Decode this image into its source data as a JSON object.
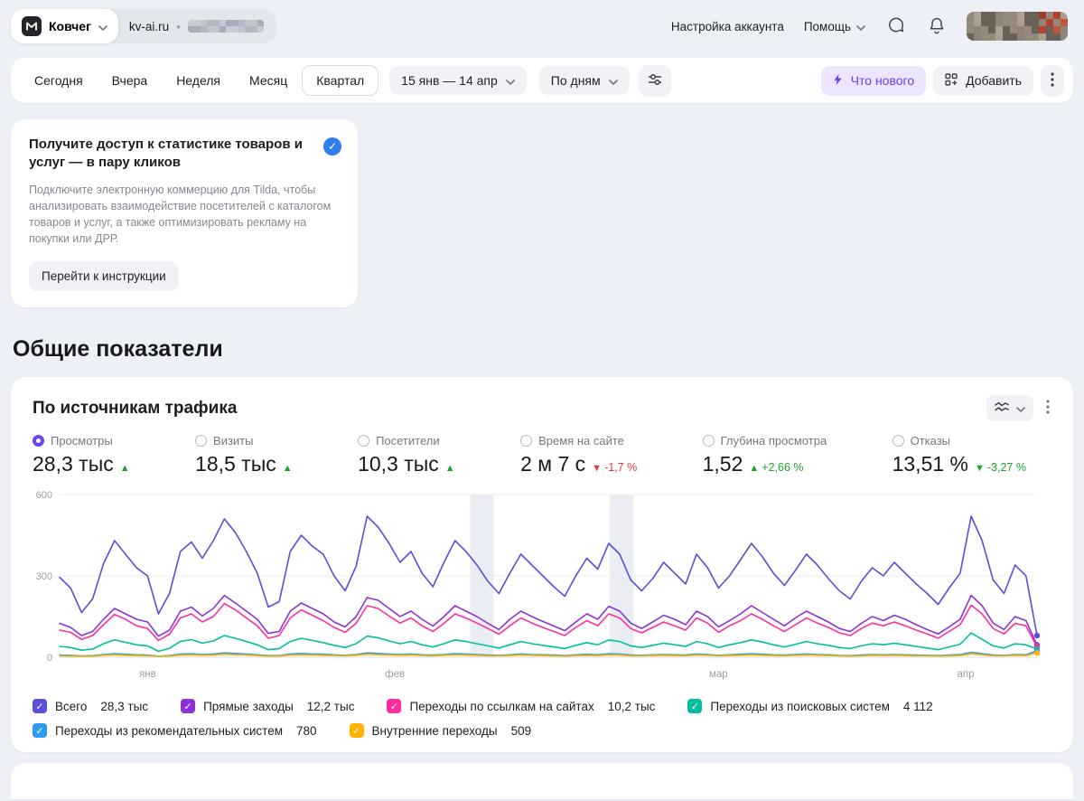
{
  "header": {
    "counter_name": "Ковчег",
    "site": "kv-ai.ru",
    "separator": "•",
    "account_settings": "Настройка аккаунта",
    "help": "Помощь"
  },
  "toolbar": {
    "periods": [
      "Сегодня",
      "Вчера",
      "Неделя",
      "Месяц",
      "Квартал"
    ],
    "selected_period": "Квартал",
    "date_range": "15 янв — 14 апр",
    "granularity": "По дням",
    "whats_new": "Что нового",
    "add": "Добавить"
  },
  "promo": {
    "title": "Получите доступ к статистике товаров и услуг — в пару кликов",
    "body": "Подключите электронную коммерцию для Tilda, чтобы анализировать взаимодействие посетителей с каталогом товаров и услуг, а также оптимизировать рекламу на покупки или ДРР.",
    "cta": "Перейти к инструкции"
  },
  "section_title": "Общие показатели",
  "widget": {
    "title": "По источникам трафика",
    "metrics": [
      {
        "label": "Просмотры",
        "value": "28,3 тыс",
        "dir": "up",
        "delta": "",
        "delta_color": "green",
        "selected": true
      },
      {
        "label": "Визиты",
        "value": "18,5 тыс",
        "dir": "up",
        "delta": "",
        "delta_color": "green",
        "selected": false
      },
      {
        "label": "Посетители",
        "value": "10,3 тыс",
        "dir": "up",
        "delta": "",
        "delta_color": "green",
        "selected": false
      },
      {
        "label": "Время на сайте",
        "value": "2 м 7 с",
        "dir": "down",
        "delta": "-1,7 %",
        "delta_color": "red",
        "selected": false
      },
      {
        "label": "Глубина просмотра",
        "value": "1,52",
        "dir": "up",
        "delta": "+2,66 %",
        "delta_color": "green",
        "selected": false
      },
      {
        "label": "Отказы",
        "value": "13,51 %",
        "dir": "down",
        "delta": "-3,27 %",
        "delta_color": "green",
        "selected": false
      }
    ],
    "legend": [
      {
        "label": "Всего",
        "value": "28,3 тыс",
        "color": "#5a4fd8"
      },
      {
        "label": "Прямые заходы",
        "value": "12,2 тыс",
        "color": "#8c33d6"
      },
      {
        "label": "Переходы по ссылкам на сайтах",
        "value": "10,2 тыс",
        "color": "#ff2e9c"
      },
      {
        "label": "Переходы из поисковых систем",
        "value": "4 112",
        "color": "#00bfa0"
      },
      {
        "label": "Переходы из рекомендательных систем",
        "value": "780",
        "color": "#2f9bf0"
      },
      {
        "label": "Внутренние переходы",
        "value": "509",
        "color": "#ffb200"
      }
    ]
  },
  "chart_data": {
    "type": "line",
    "title": "По источникам трафика",
    "x_unit": "день",
    "x_range": "15 янв — 14 апр",
    "granularity": "По дням",
    "x_tick_labels": [
      "янв",
      "фев",
      "мар",
      "апр"
    ],
    "x_tick_positions": [
      0.09,
      0.343,
      0.674,
      0.927
    ],
    "ylim": [
      0,
      600
    ],
    "y_ticks": [
      0,
      300,
      600
    ],
    "grid": true,
    "legend_position": "bottom",
    "highlight_bands": [
      [
        0.42,
        0.444
      ],
      [
        0.563,
        0.587
      ]
    ],
    "series": [
      {
        "name": "Всего",
        "total": "28,3 тыс",
        "color": "#5a4fd8",
        "values": [
          295,
          255,
          165,
          215,
          345,
          430,
          380,
          330,
          300,
          160,
          235,
          390,
          425,
          365,
          430,
          510,
          460,
          390,
          310,
          185,
          205,
          390,
          450,
          410,
          380,
          300,
          245,
          335,
          520,
          480,
          420,
          350,
          390,
          310,
          260,
          350,
          430,
          390,
          340,
          280,
          235,
          310,
          380,
          340,
          300,
          260,
          225,
          300,
          365,
          325,
          420,
          380,
          285,
          245,
          290,
          350,
          310,
          270,
          380,
          330,
          255,
          300,
          360,
          420,
          370,
          310,
          265,
          320,
          380,
          340,
          290,
          245,
          215,
          280,
          330,
          300,
          350,
          310,
          270,
          235,
          195,
          255,
          310,
          520,
          430,
          285,
          235,
          340,
          300,
          80
        ]
      },
      {
        "name": "Прямые заходы",
        "total": "12,2 тыс",
        "color": "#8c33d6",
        "values": [
          125,
          110,
          80,
          95,
          140,
          180,
          160,
          140,
          130,
          78,
          100,
          170,
          185,
          152,
          180,
          228,
          200,
          170,
          140,
          88,
          95,
          170,
          200,
          180,
          160,
          130,
          112,
          150,
          220,
          210,
          180,
          150,
          170,
          140,
          115,
          150,
          190,
          170,
          150,
          125,
          102,
          140,
          170,
          150,
          132,
          115,
          98,
          130,
          160,
          140,
          188,
          170,
          126,
          106,
          130,
          155,
          140,
          120,
          170,
          150,
          112,
          135,
          160,
          190,
          165,
          140,
          116,
          145,
          170,
          150,
          130,
          106,
          95,
          125,
          150,
          135,
          155,
          140,
          120,
          102,
          86,
          112,
          140,
          228,
          190,
          126,
          102,
          150,
          135,
          45
        ]
      },
      {
        "name": "Переходы по ссылкам на сайтах",
        "total": "10,2 тыс",
        "color": "#ff2e9c",
        "values": [
          100,
          92,
          66,
          80,
          120,
          158,
          140,
          116,
          106,
          62,
          85,
          145,
          160,
          130,
          150,
          198,
          175,
          145,
          116,
          70,
          80,
          145,
          175,
          155,
          135,
          110,
          92,
          125,
          190,
          180,
          152,
          126,
          145,
          116,
          95,
          125,
          160,
          145,
          126,
          106,
          85,
          116,
          145,
          126,
          110,
          95,
          80,
          110,
          135,
          116,
          160,
          145,
          106,
          90,
          110,
          130,
          116,
          100,
          145,
          126,
          92,
          116,
          135,
          160,
          140,
          116,
          95,
          120,
          145,
          126,
          110,
          90,
          80,
          106,
          126,
          116,
          130,
          116,
          100,
          86,
          70,
          95,
          120,
          192,
          160,
          106,
          86,
          125,
          116,
          38
        ]
      },
      {
        "name": "Переходы из поисковых систем",
        "total": "4 112",
        "color": "#00bfa0",
        "values": [
          40,
          36,
          26,
          30,
          50,
          64,
          55,
          46,
          42,
          22,
          33,
          58,
          65,
          52,
          60,
          80,
          70,
          58,
          46,
          28,
          32,
          58,
          70,
          62,
          54,
          44,
          36,
          50,
          78,
          72,
          60,
          50,
          58,
          46,
          38,
          50,
          64,
          58,
          50,
          42,
          34,
          46,
          58,
          50,
          44,
          38,
          32,
          44,
          54,
          46,
          64,
          58,
          42,
          36,
          44,
          52,
          46,
          40,
          58,
          50,
          36,
          46,
          54,
          64,
          56,
          46,
          38,
          48,
          58,
          50,
          44,
          36,
          32,
          42,
          50,
          46,
          52,
          46,
          40,
          34,
          28,
          38,
          48,
          90,
          66,
          42,
          34,
          50,
          46,
          30
        ]
      },
      {
        "name": "Переходы из рекомендательных систем",
        "total": "780",
        "color": "#2f9bf0",
        "values": [
          8,
          7,
          5,
          6,
          10,
          13,
          11,
          9,
          8,
          4,
          6,
          12,
          13,
          10,
          12,
          16,
          14,
          12,
          9,
          6,
          6,
          12,
          14,
          12,
          11,
          9,
          7,
          10,
          16,
          14,
          12,
          10,
          12,
          9,
          8,
          10,
          13,
          12,
          10,
          8,
          7,
          9,
          12,
          10,
          9,
          8,
          6,
          9,
          11,
          9,
          13,
          12,
          8,
          7,
          9,
          10,
          9,
          8,
          12,
          10,
          7,
          9,
          11,
          13,
          11,
          9,
          8,
          10,
          12,
          10,
          9,
          7,
          6,
          8,
          10,
          9,
          10,
          9,
          8,
          7,
          6,
          8,
          10,
          18,
          13,
          8,
          7,
          10,
          9,
          24
        ]
      },
      {
        "name": "Внутренние переходы",
        "total": "509",
        "color": "#ffb200",
        "values": [
          5,
          4,
          3,
          4,
          7,
          9,
          7,
          6,
          5,
          3,
          4,
          8,
          9,
          7,
          8,
          11,
          9,
          8,
          6,
          4,
          4,
          8,
          9,
          8,
          7,
          6,
          5,
          7,
          11,
          9,
          8,
          7,
          8,
          6,
          5,
          7,
          9,
          8,
          7,
          5,
          5,
          6,
          8,
          7,
          6,
          5,
          4,
          6,
          7,
          6,
          9,
          8,
          5,
          5,
          6,
          7,
          6,
          5,
          8,
          7,
          5,
          6,
          7,
          9,
          7,
          6,
          5,
          7,
          8,
          7,
          6,
          5,
          4,
          5,
          7,
          6,
          7,
          6,
          5,
          5,
          4,
          5,
          6,
          12,
          9,
          5,
          5,
          7,
          6,
          16
        ]
      }
    ]
  },
  "icons": {
    "chevron-down": "⌄",
    "bolt": "⚡",
    "add-widget": "⊞",
    "filter": "sliders",
    "kebab": "⋮",
    "chart-type": "waves",
    "check": "✓",
    "triangle-up": "▲",
    "triangle-down": "▼",
    "chat": "speech-bubble",
    "bell": "bell"
  }
}
